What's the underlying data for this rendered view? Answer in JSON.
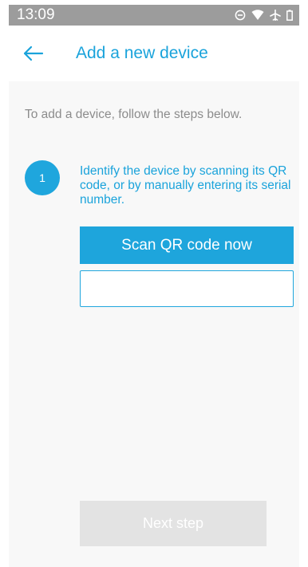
{
  "status_bar": {
    "time": "13:09",
    "icons": [
      "do-not-disturb-icon",
      "wifi-icon",
      "airplane-mode-icon",
      "battery-icon"
    ]
  },
  "app_bar": {
    "back_icon": "back-arrow-icon",
    "title": "Add a new device"
  },
  "intro": {
    "text": "To add a device, follow the steps below."
  },
  "step": {
    "number": "1",
    "instruction": "Identify the device by scanning its QR code, or by manually entering its serial number."
  },
  "actions": {
    "scan_label": "Scan QR code now",
    "serial_value": "",
    "next_label": "Next step",
    "next_enabled": false
  },
  "colors": {
    "accent": "#1fa6dd",
    "status_bar": "#9c9c9c",
    "disabled": "#e3e3e3",
    "muted_text": "#8c8c8c"
  }
}
